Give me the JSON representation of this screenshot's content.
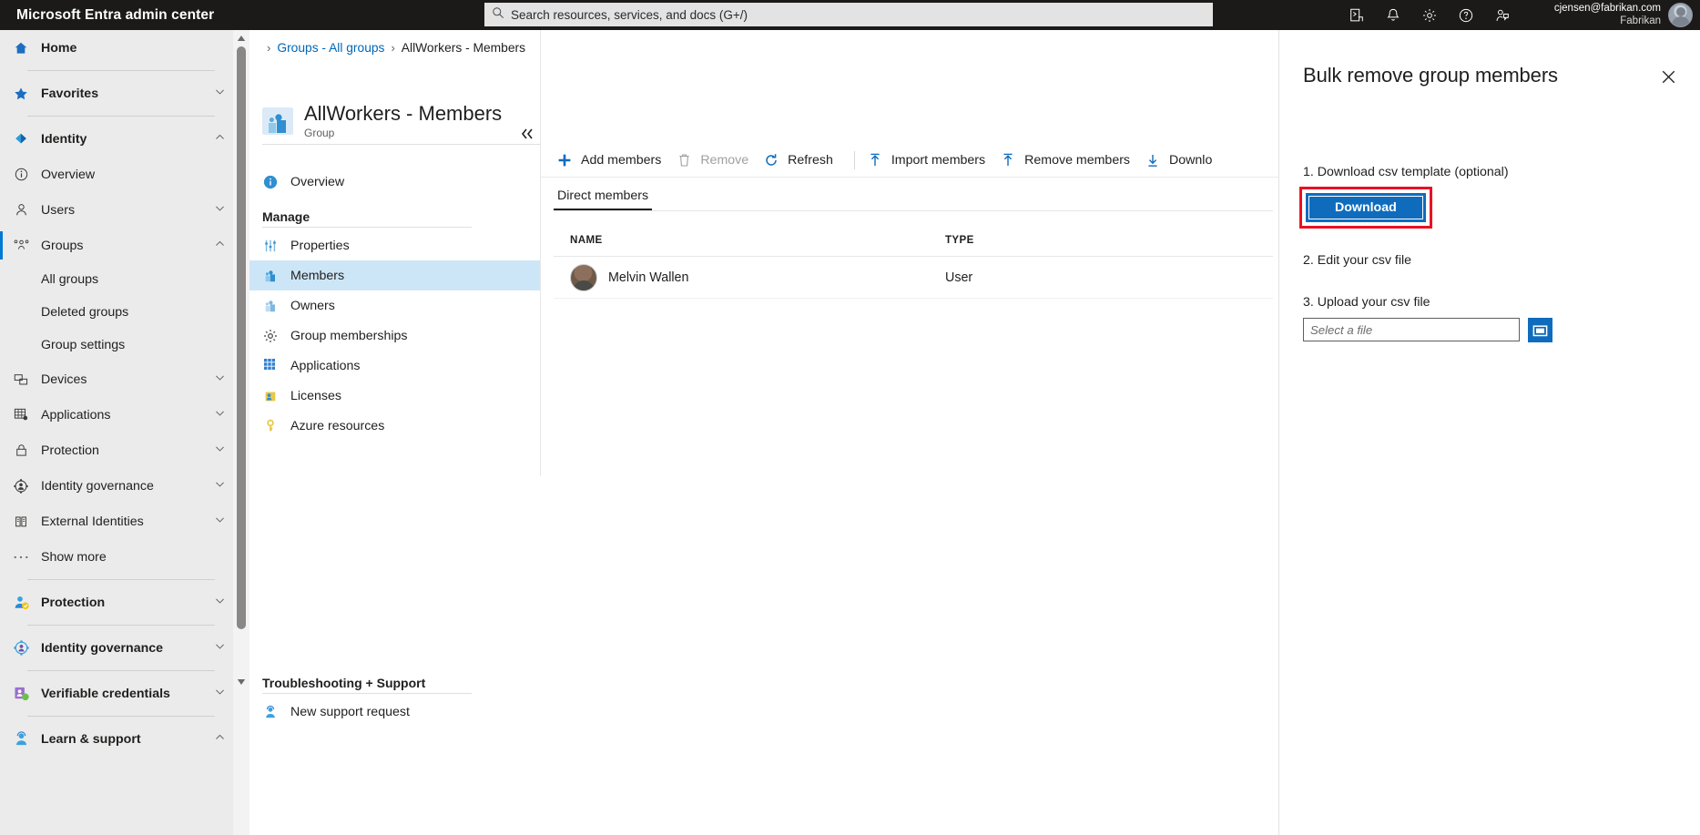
{
  "header": {
    "brand": "Microsoft Entra admin center",
    "search": {
      "placeholder": "Search resources, services, and docs (G+/)",
      "icon": "search-icon"
    },
    "icons": [
      {
        "name": "cloud-shell-icon",
        "label": "Cloud Shell"
      },
      {
        "name": "bell-icon",
        "label": "Notifications"
      },
      {
        "name": "gear-icon",
        "label": "Settings"
      },
      {
        "name": "help-icon",
        "label": "Help"
      },
      {
        "name": "feedback-icon",
        "label": "Feedback"
      }
    ],
    "account": {
      "email": "cjensen@fabrikan.com",
      "tenant": "Fabrikan",
      "avatar": "user-avatar"
    }
  },
  "sidebar": {
    "items": [
      {
        "label": "Home",
        "icon": "home-icon",
        "bold": true,
        "chevron": null,
        "type": "item"
      },
      {
        "type": "divider"
      },
      {
        "label": "Favorites",
        "icon": "star-icon",
        "bold": true,
        "chevron": "down",
        "type": "item"
      },
      {
        "type": "divider"
      },
      {
        "label": "Identity",
        "icon": "identity-icon",
        "bold": true,
        "chevron": "up",
        "type": "item"
      },
      {
        "label": "Overview",
        "icon": "info-icon",
        "bold": false,
        "chevron": null,
        "type": "item"
      },
      {
        "label": "Users",
        "icon": "user-icon",
        "bold": false,
        "chevron": "down",
        "type": "item"
      },
      {
        "label": "Groups",
        "icon": "groups-icon",
        "bold": false,
        "chevron": "up",
        "type": "item",
        "selected": true
      },
      {
        "label": "All groups",
        "type": "sub"
      },
      {
        "label": "Deleted groups",
        "type": "sub"
      },
      {
        "label": "Group settings",
        "type": "sub"
      },
      {
        "label": "Devices",
        "icon": "devices-icon",
        "bold": false,
        "chevron": "down",
        "type": "item"
      },
      {
        "label": "Applications",
        "icon": "applications-icon",
        "bold": false,
        "chevron": "down",
        "type": "item"
      },
      {
        "label": "Protection",
        "icon": "lock-icon",
        "bold": false,
        "chevron": "down",
        "type": "item"
      },
      {
        "label": "Identity governance",
        "icon": "governance-icon",
        "bold": false,
        "chevron": "down",
        "type": "item"
      },
      {
        "label": "External Identities",
        "icon": "external-identities-icon",
        "bold": false,
        "chevron": "down",
        "type": "item"
      },
      {
        "label": "Show more",
        "icon": "ellipsis-icon",
        "bold": false,
        "chevron": null,
        "type": "item"
      },
      {
        "type": "divider"
      },
      {
        "label": "Protection",
        "icon": "protection-color-icon",
        "bold": true,
        "chevron": "down",
        "type": "item"
      },
      {
        "type": "divider"
      },
      {
        "label": "Identity governance",
        "icon": "governance-color-icon",
        "bold": true,
        "chevron": "down",
        "type": "item"
      },
      {
        "type": "divider"
      },
      {
        "label": "Verifiable credentials",
        "icon": "verifiable-credentials-icon",
        "bold": true,
        "chevron": "down",
        "type": "item"
      },
      {
        "type": "divider"
      },
      {
        "label": "Learn & support",
        "icon": "learn-support-icon",
        "bold": true,
        "chevron": "up",
        "type": "item"
      }
    ]
  },
  "breadcrumb": {
    "parts": [
      {
        "text": "Groups - All groups",
        "link": true
      },
      {
        "text": "AllWorkers - Members",
        "link": false
      }
    ]
  },
  "blade": {
    "title": "AllWorkers - Members",
    "subtitle": "Group",
    "icon": "group-icon",
    "nav": [
      {
        "label": "Overview",
        "icon": "overview-info-icon",
        "type": "item"
      },
      {
        "label": "Manage",
        "type": "heading"
      },
      {
        "label": "Properties",
        "icon": "properties-icon",
        "type": "item"
      },
      {
        "label": "Members",
        "icon": "members-icon",
        "type": "item",
        "active": true
      },
      {
        "label": "Owners",
        "icon": "owners-icon",
        "type": "item"
      },
      {
        "label": "Group memberships",
        "icon": "group-memberships-gear-icon",
        "type": "item"
      },
      {
        "label": "Applications",
        "icon": "applications-grid-icon",
        "type": "item"
      },
      {
        "label": "Licenses",
        "icon": "licenses-icon",
        "type": "item"
      },
      {
        "label": "Azure resources",
        "icon": "azure-resources-key-icon",
        "type": "item"
      }
    ],
    "support": {
      "heading": "Troubleshooting + Support",
      "items": [
        {
          "label": "New support request",
          "icon": "support-agent-icon"
        }
      ]
    },
    "collapse_icon": "collapse-chevrons-icon"
  },
  "commandbar": {
    "buttons": [
      {
        "label": "Add members",
        "icon": "plus-icon",
        "disabled": false
      },
      {
        "label": "Remove",
        "icon": "trash-icon",
        "disabled": true
      },
      {
        "label": "Refresh",
        "icon": "refresh-icon",
        "disabled": false
      },
      {
        "separator": true
      },
      {
        "label": "Import members",
        "icon": "upload-icon",
        "disabled": false
      },
      {
        "label": "Remove members",
        "icon": "upload-icon",
        "disabled": false
      },
      {
        "label": "Downlo",
        "icon": "download-icon",
        "disabled": false
      }
    ]
  },
  "tabs": [
    {
      "label": "Direct members",
      "active": true
    }
  ],
  "grid": {
    "columns": [
      "NAME",
      "TYPE"
    ],
    "rows": [
      {
        "name": "Melvin Wallen",
        "type": "User",
        "avatar": "member-avatar"
      }
    ]
  },
  "right_panel": {
    "title": "Bulk remove group members",
    "close_icon": "close-icon",
    "step1_label": "1. Download csv template (optional)",
    "download_button": "Download",
    "step2_label": "2. Edit your csv file",
    "step3_label": "3. Upload your csv file",
    "file_placeholder": "Select a file",
    "browse_icon": "folder-icon"
  },
  "colors": {
    "brand_blue": "#0078d4",
    "button_blue": "#0f6cbd",
    "highlight_red": "#e81123",
    "header_dark": "#1b1a19",
    "sidebar_gray": "#ebebeb",
    "selected_row": "#cde6f7"
  }
}
